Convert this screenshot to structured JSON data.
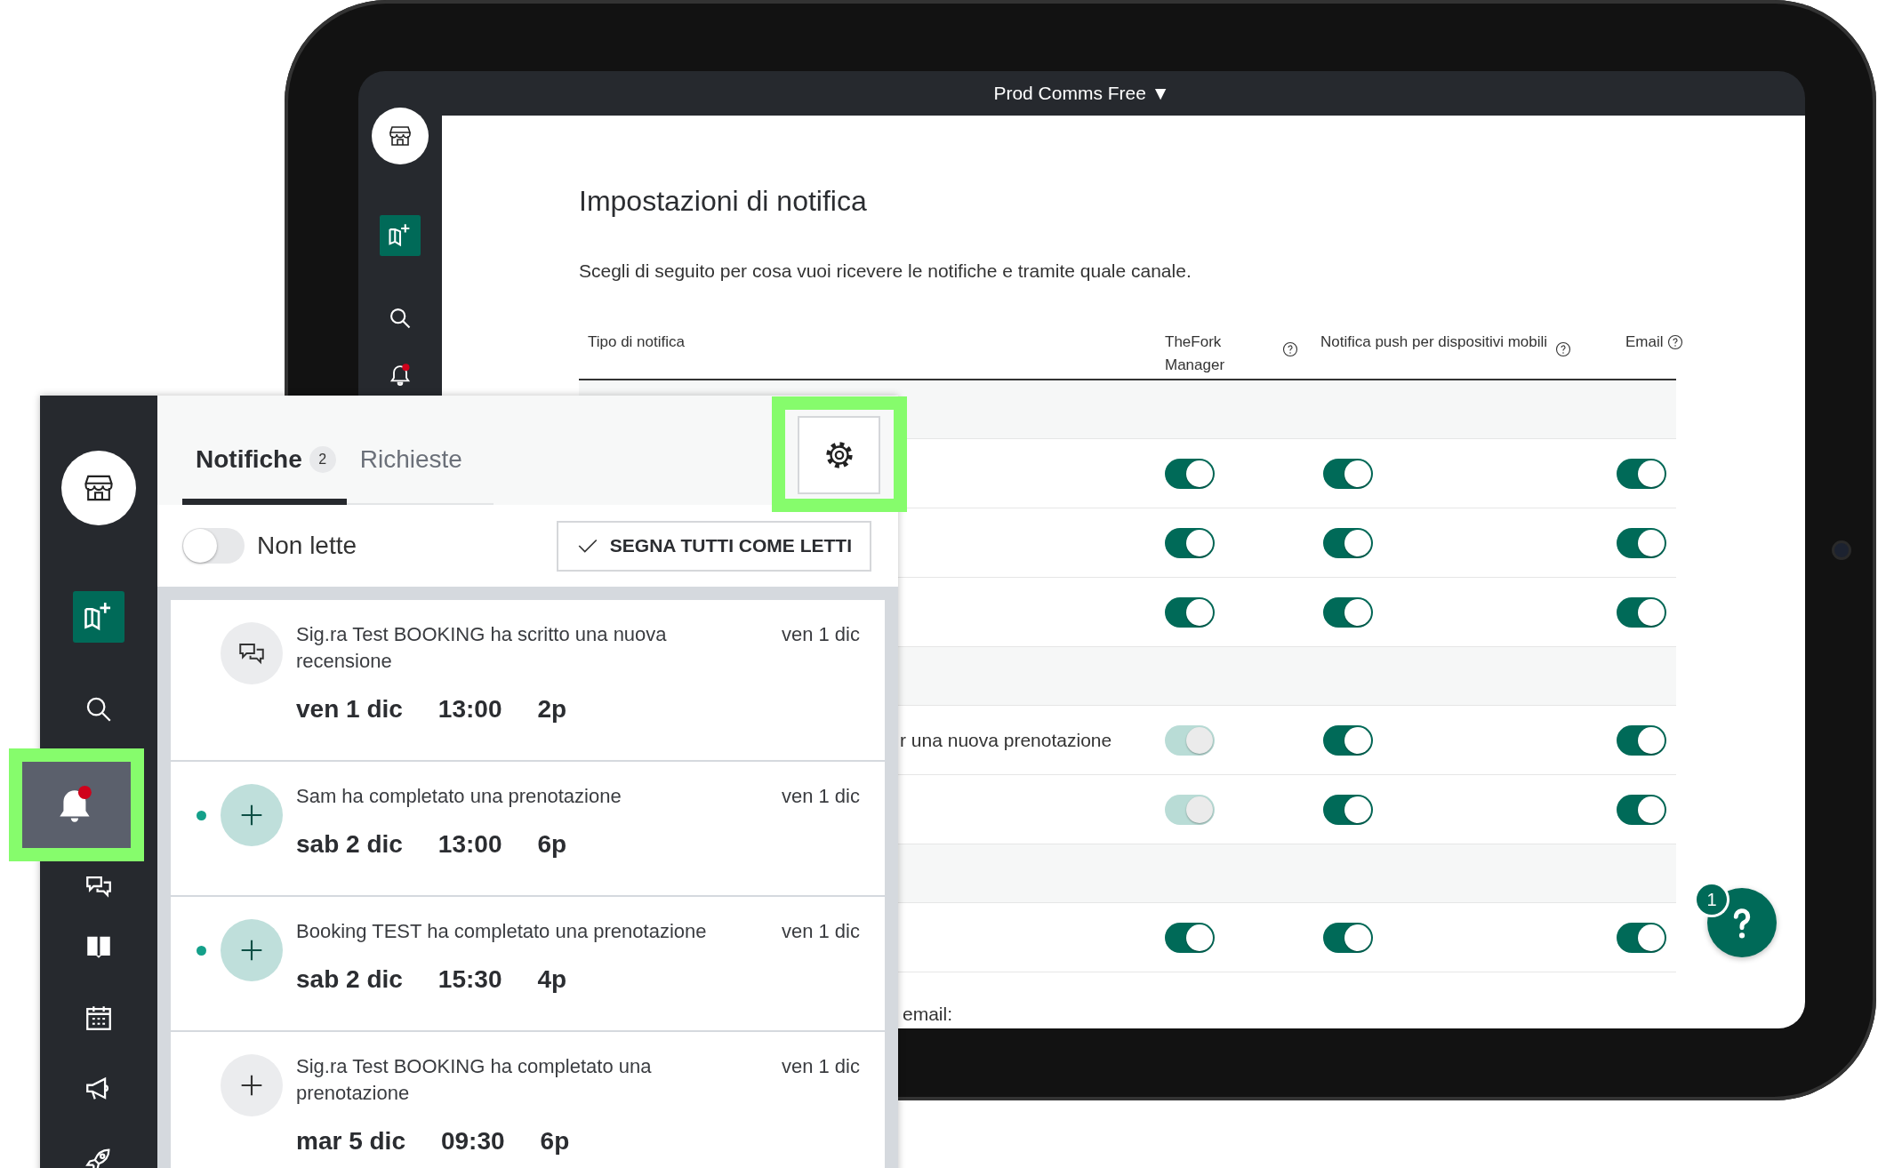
{
  "tablet": {
    "account_menu": {
      "label": "Prod Comms Free",
      "caret": "▼"
    },
    "sidebar": [
      {
        "kind": "store"
      },
      {
        "kind": "new-booking"
      },
      {
        "kind": "search"
      },
      {
        "kind": "notifications"
      }
    ],
    "page": {
      "title": "Impostazioni di notifica",
      "description": "Scegli di seguito per cosa vuoi ricevere le notifiche e tramite quale canale.",
      "table": {
        "columns": [
          {
            "label": "Tipo di notifica",
            "help": false
          },
          {
            "label": "TheFork Manager",
            "help": true
          },
          {
            "label": "Notifica push per dispositivi mobili",
            "help": true
          },
          {
            "label": "Email",
            "help": true
          }
        ],
        "rows": [
          {
            "kind": "section"
          },
          {
            "kind": "setting",
            "toggles": [
              {
                "on": true,
                "disabled": false
              },
              {
                "on": true,
                "disabled": false
              },
              {
                "on": true,
                "disabled": false
              }
            ]
          },
          {
            "kind": "setting",
            "toggles": [
              {
                "on": true,
                "disabled": false
              },
              {
                "on": true,
                "disabled": false
              },
              {
                "on": true,
                "disabled": false
              }
            ]
          },
          {
            "kind": "setting",
            "toggles": [
              {
                "on": true,
                "disabled": false
              },
              {
                "on": true,
                "disabled": false
              },
              {
                "on": true,
                "disabled": false
              }
            ]
          },
          {
            "kind": "section"
          },
          {
            "kind": "setting",
            "label": "r una nuova prenotazione",
            "toggles": [
              {
                "on": true,
                "disabled": true
              },
              {
                "on": true,
                "disabled": false
              },
              {
                "on": true,
                "disabled": false
              }
            ]
          },
          {
            "kind": "setting",
            "toggles": [
              {
                "on": true,
                "disabled": true
              },
              {
                "on": true,
                "disabled": false
              },
              {
                "on": true,
                "disabled": false
              }
            ]
          },
          {
            "kind": "section"
          },
          {
            "kind": "setting",
            "toggles": [
              {
                "on": true,
                "disabled": false
              },
              {
                "on": true,
                "disabled": false
              },
              {
                "on": true,
                "disabled": false
              }
            ]
          }
        ]
      },
      "footer_text": "email:"
    },
    "help_button": {
      "badge": "1"
    }
  },
  "panel": {
    "sidebar": [
      {
        "kind": "store",
        "selected": false,
        "highlighted": false
      },
      {
        "kind": "new-booking",
        "selected": false,
        "highlighted": false
      },
      {
        "kind": "search",
        "selected": false,
        "highlighted": false
      },
      {
        "kind": "notifications",
        "selected": true,
        "highlighted": true
      },
      {
        "kind": "chat",
        "selected": false,
        "highlighted": false
      },
      {
        "kind": "book",
        "selected": false,
        "highlighted": false
      },
      {
        "kind": "calendar",
        "selected": false,
        "highlighted": false
      },
      {
        "kind": "megaphone",
        "selected": false,
        "highlighted": false
      },
      {
        "kind": "rocket",
        "selected": false,
        "highlighted": false
      }
    ],
    "tabs": [
      {
        "label": "Notifiche",
        "badge": "2",
        "selected": true
      },
      {
        "label": "Richieste",
        "selected": false
      }
    ],
    "settings_button": {
      "highlighted": true
    },
    "unread_filter": {
      "label": "Non lette",
      "on": false
    },
    "mark_all_button": "SEGNA TUTTI COME LETTI",
    "notifications": [
      {
        "kind": "review",
        "unread": false,
        "text": "Sig.ra Test BOOKING ha scritto una nuova recensione",
        "date": "ven 1 dic",
        "booking": {
          "day": "ven 1 dic",
          "time": "13:00",
          "guests": "2p"
        }
      },
      {
        "kind": "booking",
        "unread": true,
        "text": "Sam ha completato una prenotazione",
        "date": "ven 1 dic",
        "booking": {
          "day": "sab 2 dic",
          "time": "13:00",
          "guests": "6p"
        }
      },
      {
        "kind": "booking",
        "unread": true,
        "text": "Booking TEST ha completato una prenotazione",
        "date": "ven 1 dic",
        "booking": {
          "day": "sab 2 dic",
          "time": "15:30",
          "guests": "4p"
        }
      },
      {
        "kind": "booking",
        "unread": false,
        "text": "Sig.ra Test BOOKING ha completato una prenotazione",
        "date": "ven 1 dic",
        "booking": {
          "day": "mar 5 dic",
          "time": "09:30",
          "guests": "6p"
        }
      }
    ]
  }
}
